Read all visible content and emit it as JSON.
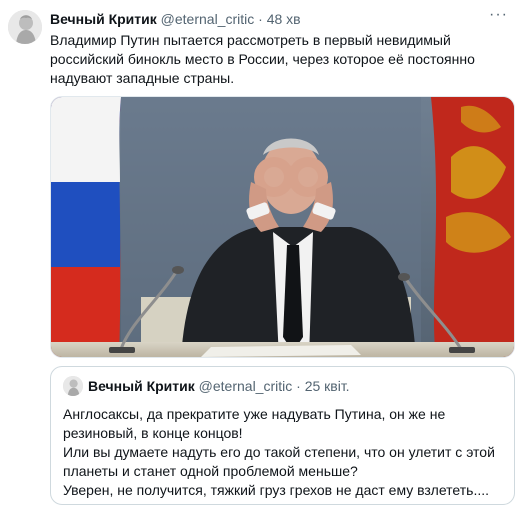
{
  "tweet": {
    "author_name": "Вечный Критик",
    "handle": "@eternal_critic",
    "separator": "·",
    "time": "48 хв",
    "text": "Владимир Путин пытается рассмотреть в первый невидимый российский бинокль место в России, через которое её постоянно надувают западные страны.",
    "more_label": "···"
  },
  "media": {
    "flag_colors": [
      "#ffffff",
      "#1f4fbf",
      "#d52b1e"
    ]
  },
  "quoted": {
    "author_name": "Вечный Критик",
    "handle": "@eternal_critic",
    "separator": "·",
    "time": "25 квіт.",
    "lines": [
      "Англосаксы, да прекратите уже надувать Путина, он же не",
      "резиновый, в конце концов!",
      "Или вы думаете надуть его до такой степени, что он улетит с этой",
      "планеты и станет одной проблемой меньше?",
      "Уверен, не получится, тяжкий груз грехов не даст ему взлететь...."
    ]
  }
}
